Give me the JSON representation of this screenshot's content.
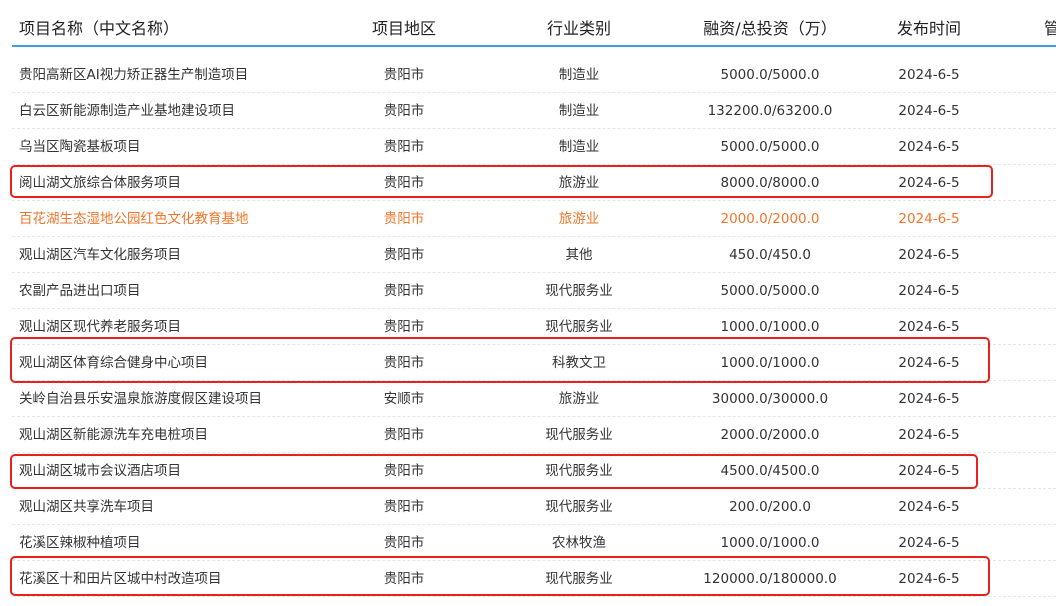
{
  "table": {
    "headers": {
      "name": "项目名称（中文名称）",
      "region": "项目地区",
      "industry": "行业类别",
      "financing": "融资/总投资（万）",
      "date": "发布时间",
      "extra": "管"
    },
    "rows": [
      {
        "name": "贵阳高新区AI视力矫正器生产制造项目",
        "region": "贵阳市",
        "industry": "制造业",
        "financing": "5000.0/5000.0",
        "date": "2024-6-5"
      },
      {
        "name": "白云区新能源制造产业基地建设项目",
        "region": "贵阳市",
        "industry": "制造业",
        "financing": "132200.0/63200.0",
        "date": "2024-6-5"
      },
      {
        "name": "乌当区陶瓷基板项目",
        "region": "贵阳市",
        "industry": "制造业",
        "financing": "5000.0/5000.0",
        "date": "2024-6-5"
      },
      {
        "name": "阅山湖文旅综合体服务项目",
        "region": "贵阳市",
        "industry": "旅游业",
        "financing": "8000.0/8000.0",
        "date": "2024-6-5"
      },
      {
        "name": "百花湖生态湿地公园红色文化教育基地",
        "region": "贵阳市",
        "industry": "旅游业",
        "financing": "2000.0/2000.0",
        "date": "2024-6-5"
      },
      {
        "name": "观山湖区汽车文化服务项目",
        "region": "贵阳市",
        "industry": "其他",
        "financing": "450.0/450.0",
        "date": "2024-6-5"
      },
      {
        "name": "农副产品进出口项目",
        "region": "贵阳市",
        "industry": "现代服务业",
        "financing": "5000.0/5000.0",
        "date": "2024-6-5"
      },
      {
        "name": "观山湖区现代养老服务项目",
        "region": "贵阳市",
        "industry": "现代服务业",
        "financing": "1000.0/1000.0",
        "date": "2024-6-5"
      },
      {
        "name": "观山湖区体育综合健身中心项目",
        "region": "贵阳市",
        "industry": "科教文卫",
        "financing": "1000.0/1000.0",
        "date": "2024-6-5"
      },
      {
        "name": "关岭自治县乐安温泉旅游度假区建设项目",
        "region": "安顺市",
        "industry": "旅游业",
        "financing": "30000.0/30000.0",
        "date": "2024-6-5"
      },
      {
        "name": "观山湖区新能源洗车充电桩项目",
        "region": "贵阳市",
        "industry": "现代服务业",
        "financing": "2000.0/2000.0",
        "date": "2024-6-5"
      },
      {
        "name": "观山湖区城市会议酒店项目",
        "region": "贵阳市",
        "industry": "现代服务业",
        "financing": "4500.0/4500.0",
        "date": "2024-6-5"
      },
      {
        "name": "观山湖区共享洗车项目",
        "region": "贵阳市",
        "industry": "现代服务业",
        "financing": "200.0/200.0",
        "date": "2024-6-5"
      },
      {
        "name": "花溪区辣椒种植项目",
        "region": "贵阳市",
        "industry": "农林牧渔",
        "financing": "1000.0/1000.0",
        "date": "2024-6-5"
      },
      {
        "name": "花溪区十和田片区城中村改造项目",
        "region": "贵阳市",
        "industry": "现代服务业",
        "financing": "120000.0/180000.0",
        "date": "2024-6-5"
      }
    ]
  },
  "colors": {
    "header_line": "#3a9ee0",
    "hover_text": "#f0762a",
    "annotation_box": "#e8201e"
  }
}
